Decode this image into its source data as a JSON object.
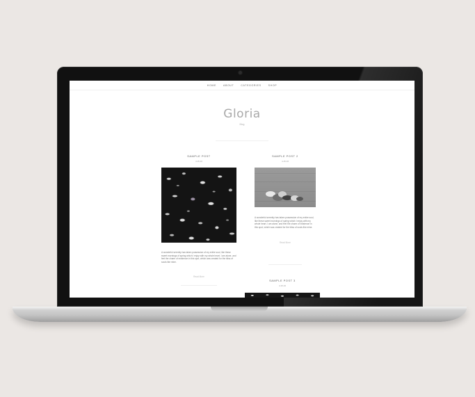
{
  "nav": {
    "items": [
      {
        "label": "HOME"
      },
      {
        "label": "ABOUT"
      },
      {
        "label": "CATEGORIES"
      },
      {
        "label": "SHOP"
      }
    ]
  },
  "site": {
    "title": "Gloria",
    "tagline": "Blog"
  },
  "posts": [
    {
      "title": "SAMPLE POST",
      "date": "4.15.16",
      "excerpt": "A wonderful serenity has taken possession of my entire soul, like these sweet mornings of spring which I enjoy with my whole heart. I am alone, and feel the charm of existence in this spot, which was created for the bliss of souls like mine.",
      "read_more": "Read More",
      "image": "leaves-photo"
    },
    {
      "title": "SAMPLE POST 2",
      "date": "4.15.16",
      "excerpt": "A wonderful serenity has taken possession of my entire soul, like these sweet mornings of spring which I enjoy with my whole heart. I am alone, and feel the charm of existence in this spot, which was created for the bliss of souls like mine.",
      "read_more": "Read More",
      "image": "cats-photo"
    },
    {
      "title": "SAMPLE POST 3",
      "date": "4.15.16",
      "image": "leaves-photo"
    }
  ],
  "colors": {
    "background": "#ebe7e4",
    "laptop_bezel": "#111111",
    "title_gray": "#a9a9a9"
  }
}
